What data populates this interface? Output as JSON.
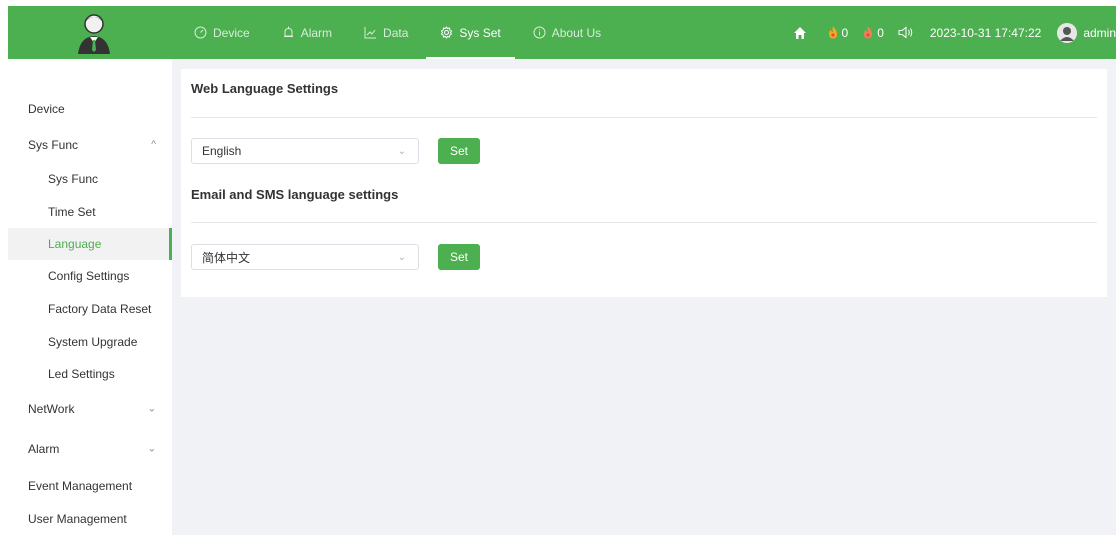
{
  "header": {
    "nav": [
      {
        "label": "Device",
        "icon": "gauge-icon"
      },
      {
        "label": "Alarm",
        "icon": "bell-icon"
      },
      {
        "label": "Data",
        "icon": "chart-icon"
      },
      {
        "label": "Sys Set",
        "icon": "gear-icon",
        "active": true
      },
      {
        "label": "About Us",
        "icon": "info-icon"
      }
    ],
    "alarm_count_1": "0",
    "alarm_count_2": "0",
    "datetime": "2023-10-31 17:47:22",
    "user": "admin",
    "colors": {
      "bar": "#4caf50",
      "badge1": "#f5a623",
      "badge2": "#e84a3c"
    }
  },
  "sidebar": {
    "items": [
      {
        "label": "Device"
      },
      {
        "label": "Sys Func",
        "expanded": true
      },
      {
        "label": "Sys Func"
      },
      {
        "label": "Time Set"
      },
      {
        "label": "Language",
        "active": true
      },
      {
        "label": "Config Settings"
      },
      {
        "label": "Factory Data Reset"
      },
      {
        "label": "System Upgrade"
      },
      {
        "label": "Led Settings"
      },
      {
        "label": "NetWork",
        "expanded": false
      },
      {
        "label": "Alarm",
        "expanded": false
      },
      {
        "label": "Event Management"
      },
      {
        "label": "User Management"
      }
    ]
  },
  "main": {
    "web_title": "Web Language Settings",
    "web_select_value": "English",
    "web_set_label": "Set",
    "email_title": "Email and SMS language settings",
    "email_select_value": "简体中文",
    "email_set_label": "Set"
  }
}
